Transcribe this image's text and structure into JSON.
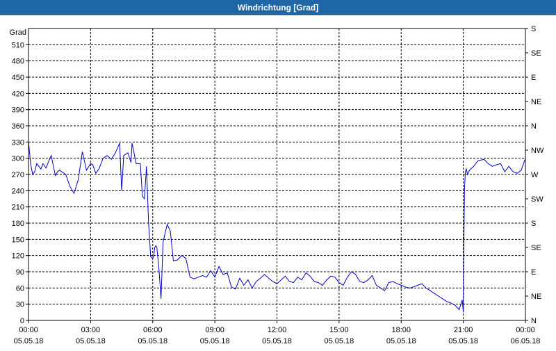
{
  "window": {
    "title": "Windrichtung [Grad]"
  },
  "chart_data": {
    "type": "line",
    "title": "Windrichtung [Grad]",
    "ylabel": "Grad",
    "ylim": [
      0,
      540
    ],
    "y_ticks": [
      0,
      30,
      60,
      90,
      120,
      150,
      180,
      210,
      240,
      270,
      300,
      330,
      360,
      390,
      420,
      450,
      480,
      510
    ],
    "xlim_hours": [
      0,
      24
    ],
    "x_ticks": [
      {
        "h": 0,
        "time": "00:00",
        "date": "05.05.18"
      },
      {
        "h": 3,
        "time": "03:00",
        "date": "05.05.18"
      },
      {
        "h": 6,
        "time": "06:00",
        "date": "05.05.18"
      },
      {
        "h": 9,
        "time": "09:00",
        "date": "05.05.18"
      },
      {
        "h": 12,
        "time": "12:00",
        "date": "05.05.18"
      },
      {
        "h": 15,
        "time": "15:00",
        "date": "05.05.18"
      },
      {
        "h": 18,
        "time": "18:00",
        "date": "05.05.18"
      },
      {
        "h": 21,
        "time": "21:00",
        "date": "05.05.18"
      },
      {
        "h": 24,
        "time": "00:00",
        "date": "06.05.18"
      }
    ],
    "right_axis": [
      {
        "deg": 0,
        "label": "N"
      },
      {
        "deg": 45,
        "label": "NE"
      },
      {
        "deg": 90,
        "label": "E"
      },
      {
        "deg": 135,
        "label": "SE"
      },
      {
        "deg": 180,
        "label": "S"
      },
      {
        "deg": 225,
        "label": "SW"
      },
      {
        "deg": 270,
        "label": "W"
      },
      {
        "deg": 315,
        "label": "NW"
      },
      {
        "deg": 360,
        "label": "N"
      },
      {
        "deg": 405,
        "label": "NE"
      },
      {
        "deg": 450,
        "label": "E"
      },
      {
        "deg": 495,
        "label": "SE"
      },
      {
        "deg": 540,
        "label": "S"
      }
    ],
    "grid": true,
    "line_color": "#0000cc",
    "series": [
      {
        "x": [
          0.0,
          0.1,
          0.2,
          0.3,
          0.4,
          0.5,
          0.6,
          0.7,
          0.85,
          1.0,
          1.1,
          1.2,
          1.3,
          1.4,
          1.5,
          1.6,
          1.8,
          2.0,
          2.2,
          2.4,
          2.6,
          2.8,
          3.0,
          3.1,
          3.25,
          3.4,
          3.5,
          3.6,
          3.8,
          4.0,
          4.2,
          4.4,
          4.5,
          4.6,
          4.8,
          4.95,
          5.0,
          5.2,
          5.4,
          5.5,
          5.6,
          5.7,
          5.8,
          5.9,
          6.0,
          6.05,
          6.1,
          6.15,
          6.2,
          6.3,
          6.4,
          6.5,
          6.7,
          6.85,
          7.0,
          7.2,
          7.4,
          7.6,
          7.8,
          8.0,
          8.2,
          8.4,
          8.6,
          8.8,
          9.0,
          9.2,
          9.4,
          9.6,
          9.8,
          10.0,
          10.2,
          10.4,
          10.6,
          10.8,
          11.0,
          11.2,
          11.4,
          11.6,
          11.8,
          12.0,
          12.2,
          12.4,
          12.6,
          12.8,
          13.0,
          13.2,
          13.4,
          13.6,
          13.8,
          14.0,
          14.2,
          14.4,
          14.6,
          14.8,
          15.0,
          15.2,
          15.4,
          15.6,
          15.8,
          16.0,
          16.2,
          16.4,
          16.6,
          16.8,
          17.0,
          17.2,
          17.4,
          17.6,
          17.8,
          18.0,
          18.2,
          18.4,
          18.6,
          18.8,
          19.0,
          19.2,
          19.4,
          19.6,
          19.8,
          20.0,
          20.2,
          20.4,
          20.6,
          20.8,
          20.95,
          21.0,
          21.03,
          21.06,
          21.1,
          21.15,
          21.2,
          21.3,
          21.5,
          21.7,
          22.0,
          22.2,
          22.4,
          22.6,
          22.8,
          23.0,
          23.2,
          23.4,
          23.6,
          23.8,
          24.0
        ],
        "y": [
          332,
          290,
          270,
          275,
          290,
          285,
          280,
          290,
          282,
          297,
          305,
          285,
          268,
          275,
          278,
          275,
          270,
          248,
          235,
          260,
          312,
          278,
          290,
          288,
          272,
          280,
          290,
          300,
          305,
          298,
          310,
          328,
          240,
          305,
          310,
          292,
          328,
          290,
          290,
          230,
          225,
          285,
          180,
          118,
          115,
          120,
          135,
          138,
          135,
          95,
          40,
          145,
          178,
          165,
          110,
          112,
          120,
          115,
          80,
          77,
          80,
          83,
          80,
          92,
          80,
          100,
          85,
          88,
          62,
          58,
          78,
          65,
          75,
          60,
          72,
          78,
          85,
          78,
          72,
          68,
          75,
          82,
          72,
          70,
          80,
          75,
          88,
          82,
          72,
          70,
          65,
          75,
          82,
          80,
          70,
          65,
          80,
          90,
          85,
          72,
          70,
          75,
          83,
          65,
          60,
          55,
          70,
          72,
          68,
          65,
          62,
          60,
          62,
          65,
          68,
          60,
          55,
          50,
          45,
          40,
          35,
          32,
          28,
          20,
          38,
          15,
          150,
          245,
          275,
          280,
          270,
          278,
          285,
          295,
          298,
          290,
          285,
          288,
          290,
          275,
          285,
          275,
          272,
          278,
          300
        ]
      }
    ]
  }
}
